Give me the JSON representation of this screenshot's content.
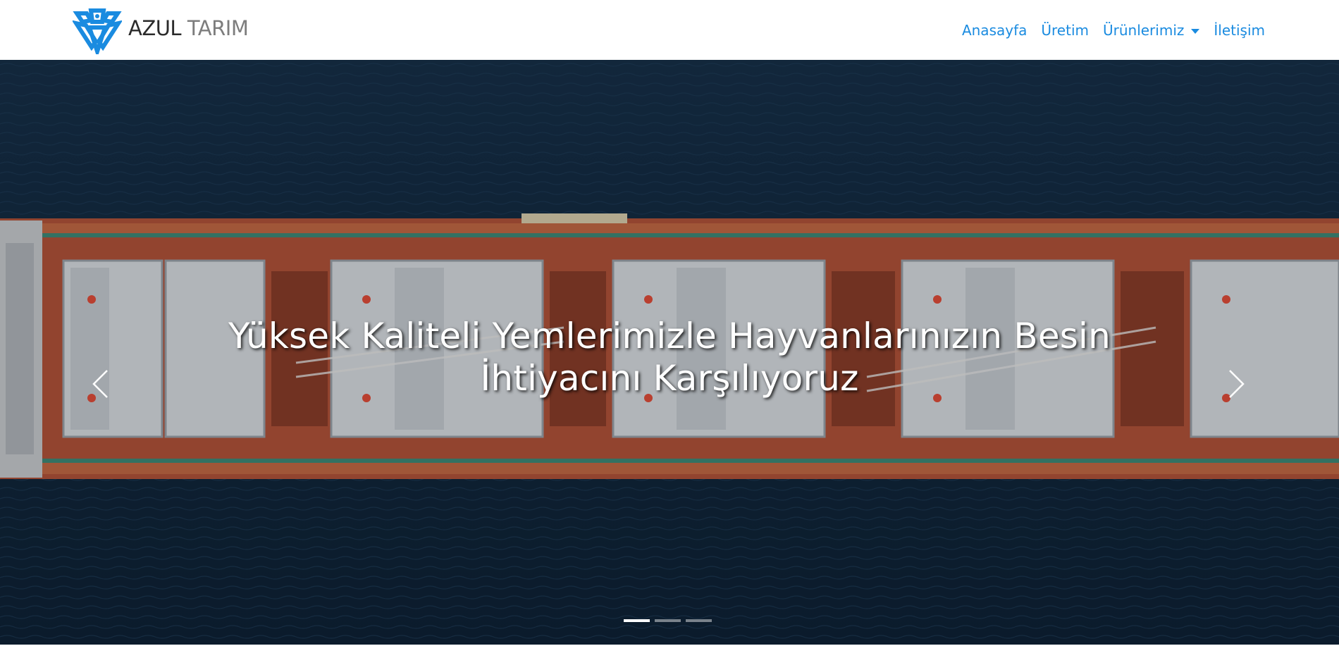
{
  "brand": {
    "word1": "AZUL",
    "word2": "TARIM",
    "logo_icon": "diamond-logo-icon",
    "logo_color": "#1a8be0"
  },
  "nav": {
    "items": [
      {
        "label": "Anasayfa"
      },
      {
        "label": "Üretim"
      },
      {
        "label": "Ürünlerimiz",
        "dropdown": true
      },
      {
        "label": "İletişim"
      }
    ],
    "link_color": "#1a8be0"
  },
  "carousel": {
    "caption_line1": "Yüksek Kaliteli Yemlerimizle Hayvanlarınızın Besin",
    "caption_line2": "İhtiyacını Karşılıyoruz",
    "prev_icon": "chevron-left-icon",
    "next_icon": "chevron-right-icon",
    "slide_count": 3,
    "active_slide": 1,
    "background_image": "aerial view of cargo ship on dark blue sea"
  }
}
